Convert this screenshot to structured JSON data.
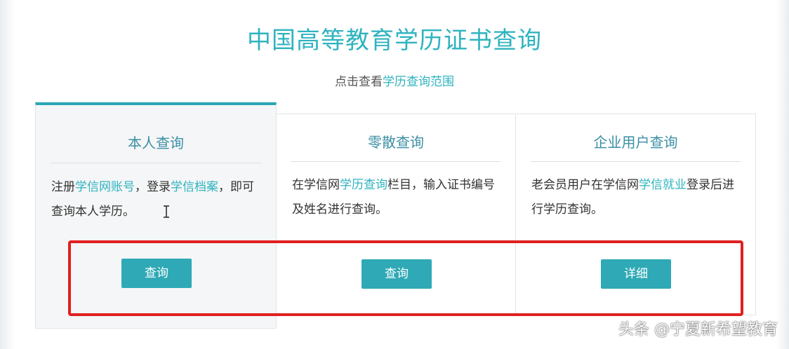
{
  "page": {
    "title": "中国高等教育学历证书查询",
    "subtitle_prefix": "点击查看",
    "subtitle_link": "学历查询范围"
  },
  "cards": [
    {
      "title": "本人查询",
      "desc": [
        "注册",
        "学信网账号",
        "，登录",
        "学信档案",
        "，即可查询本人学历。"
      ],
      "button": "查询"
    },
    {
      "title": "零散查询",
      "desc": [
        "在学信网",
        "学历查询",
        "栏目，输入证书编号及姓名进行查询。"
      ],
      "button": "查询"
    },
    {
      "title": "企业用户查询",
      "desc": [
        "老会员用户在学信网",
        "学信就业",
        "登录后进行学历查询。"
      ],
      "button": "详细"
    }
  ],
  "watermark": "头条 @宁夏新希望教育",
  "colors": {
    "accent": "#2fb3bf",
    "button": "#2fa9b6",
    "highlight_box": "#e02020"
  },
  "icons": {
    "cursor": "text-cursor-icon"
  }
}
